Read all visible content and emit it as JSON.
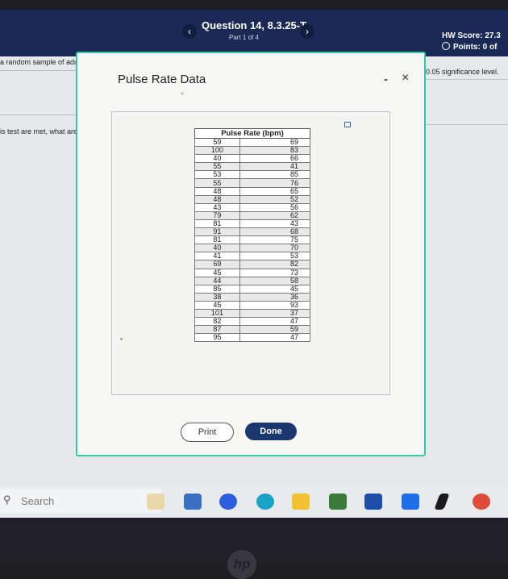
{
  "header": {
    "question_title": "Question 14, 8.3.25-T",
    "part": "Part 1 of 4",
    "prev_symbol": "‹",
    "next_symbol": "›",
    "hw_score": "HW Score: 27.3",
    "points": "Points: 0 of"
  },
  "background": {
    "text_left_1": "a random sample of adul",
    "text_left_2": "is test are met, what are",
    "text_right": "0.05 significance level."
  },
  "modal": {
    "title": "Pulse Rate Data",
    "minimize_symbol": "-",
    "close_symbol": "×",
    "table_header": "Pulse Rate (bpm)",
    "rows": [
      [
        "59",
        "69"
      ],
      [
        "100",
        "83"
      ],
      [
        "40",
        "66"
      ],
      [
        "55",
        "41"
      ],
      [
        "53",
        "85"
      ],
      [
        "55",
        "76"
      ],
      [
        "48",
        "65"
      ],
      [
        "48",
        "52"
      ],
      [
        "43",
        "56"
      ],
      [
        "79",
        "62"
      ],
      [
        "81",
        "43"
      ],
      [
        "91",
        "68"
      ],
      [
        "81",
        "75"
      ],
      [
        "40",
        "70"
      ],
      [
        "41",
        "53"
      ],
      [
        "69",
        "82"
      ],
      [
        "45",
        "73"
      ],
      [
        "44",
        "58"
      ],
      [
        "85",
        "45"
      ],
      [
        "38",
        "36"
      ],
      [
        "45",
        "93"
      ],
      [
        "101",
        "37"
      ],
      [
        "82",
        "47"
      ],
      [
        "87",
        "59"
      ],
      [
        "95",
        "47"
      ]
    ],
    "print_label": "Print",
    "done_label": "Done"
  },
  "taskbar": {
    "search_placeholder": "Search",
    "icons": [
      "file-explorer-icon",
      "widgets-icon",
      "zoom-icon",
      "edge-icon",
      "folder-icon",
      "store-icon",
      "mail-icon",
      "dropbox-icon",
      "app-icon",
      "chrome-icon"
    ]
  },
  "device": {
    "logo": "hp"
  },
  "colors": {
    "header_bg": "#1a2a55",
    "modal_border": "#35c8a4",
    "done_bg": "#1b3770"
  }
}
